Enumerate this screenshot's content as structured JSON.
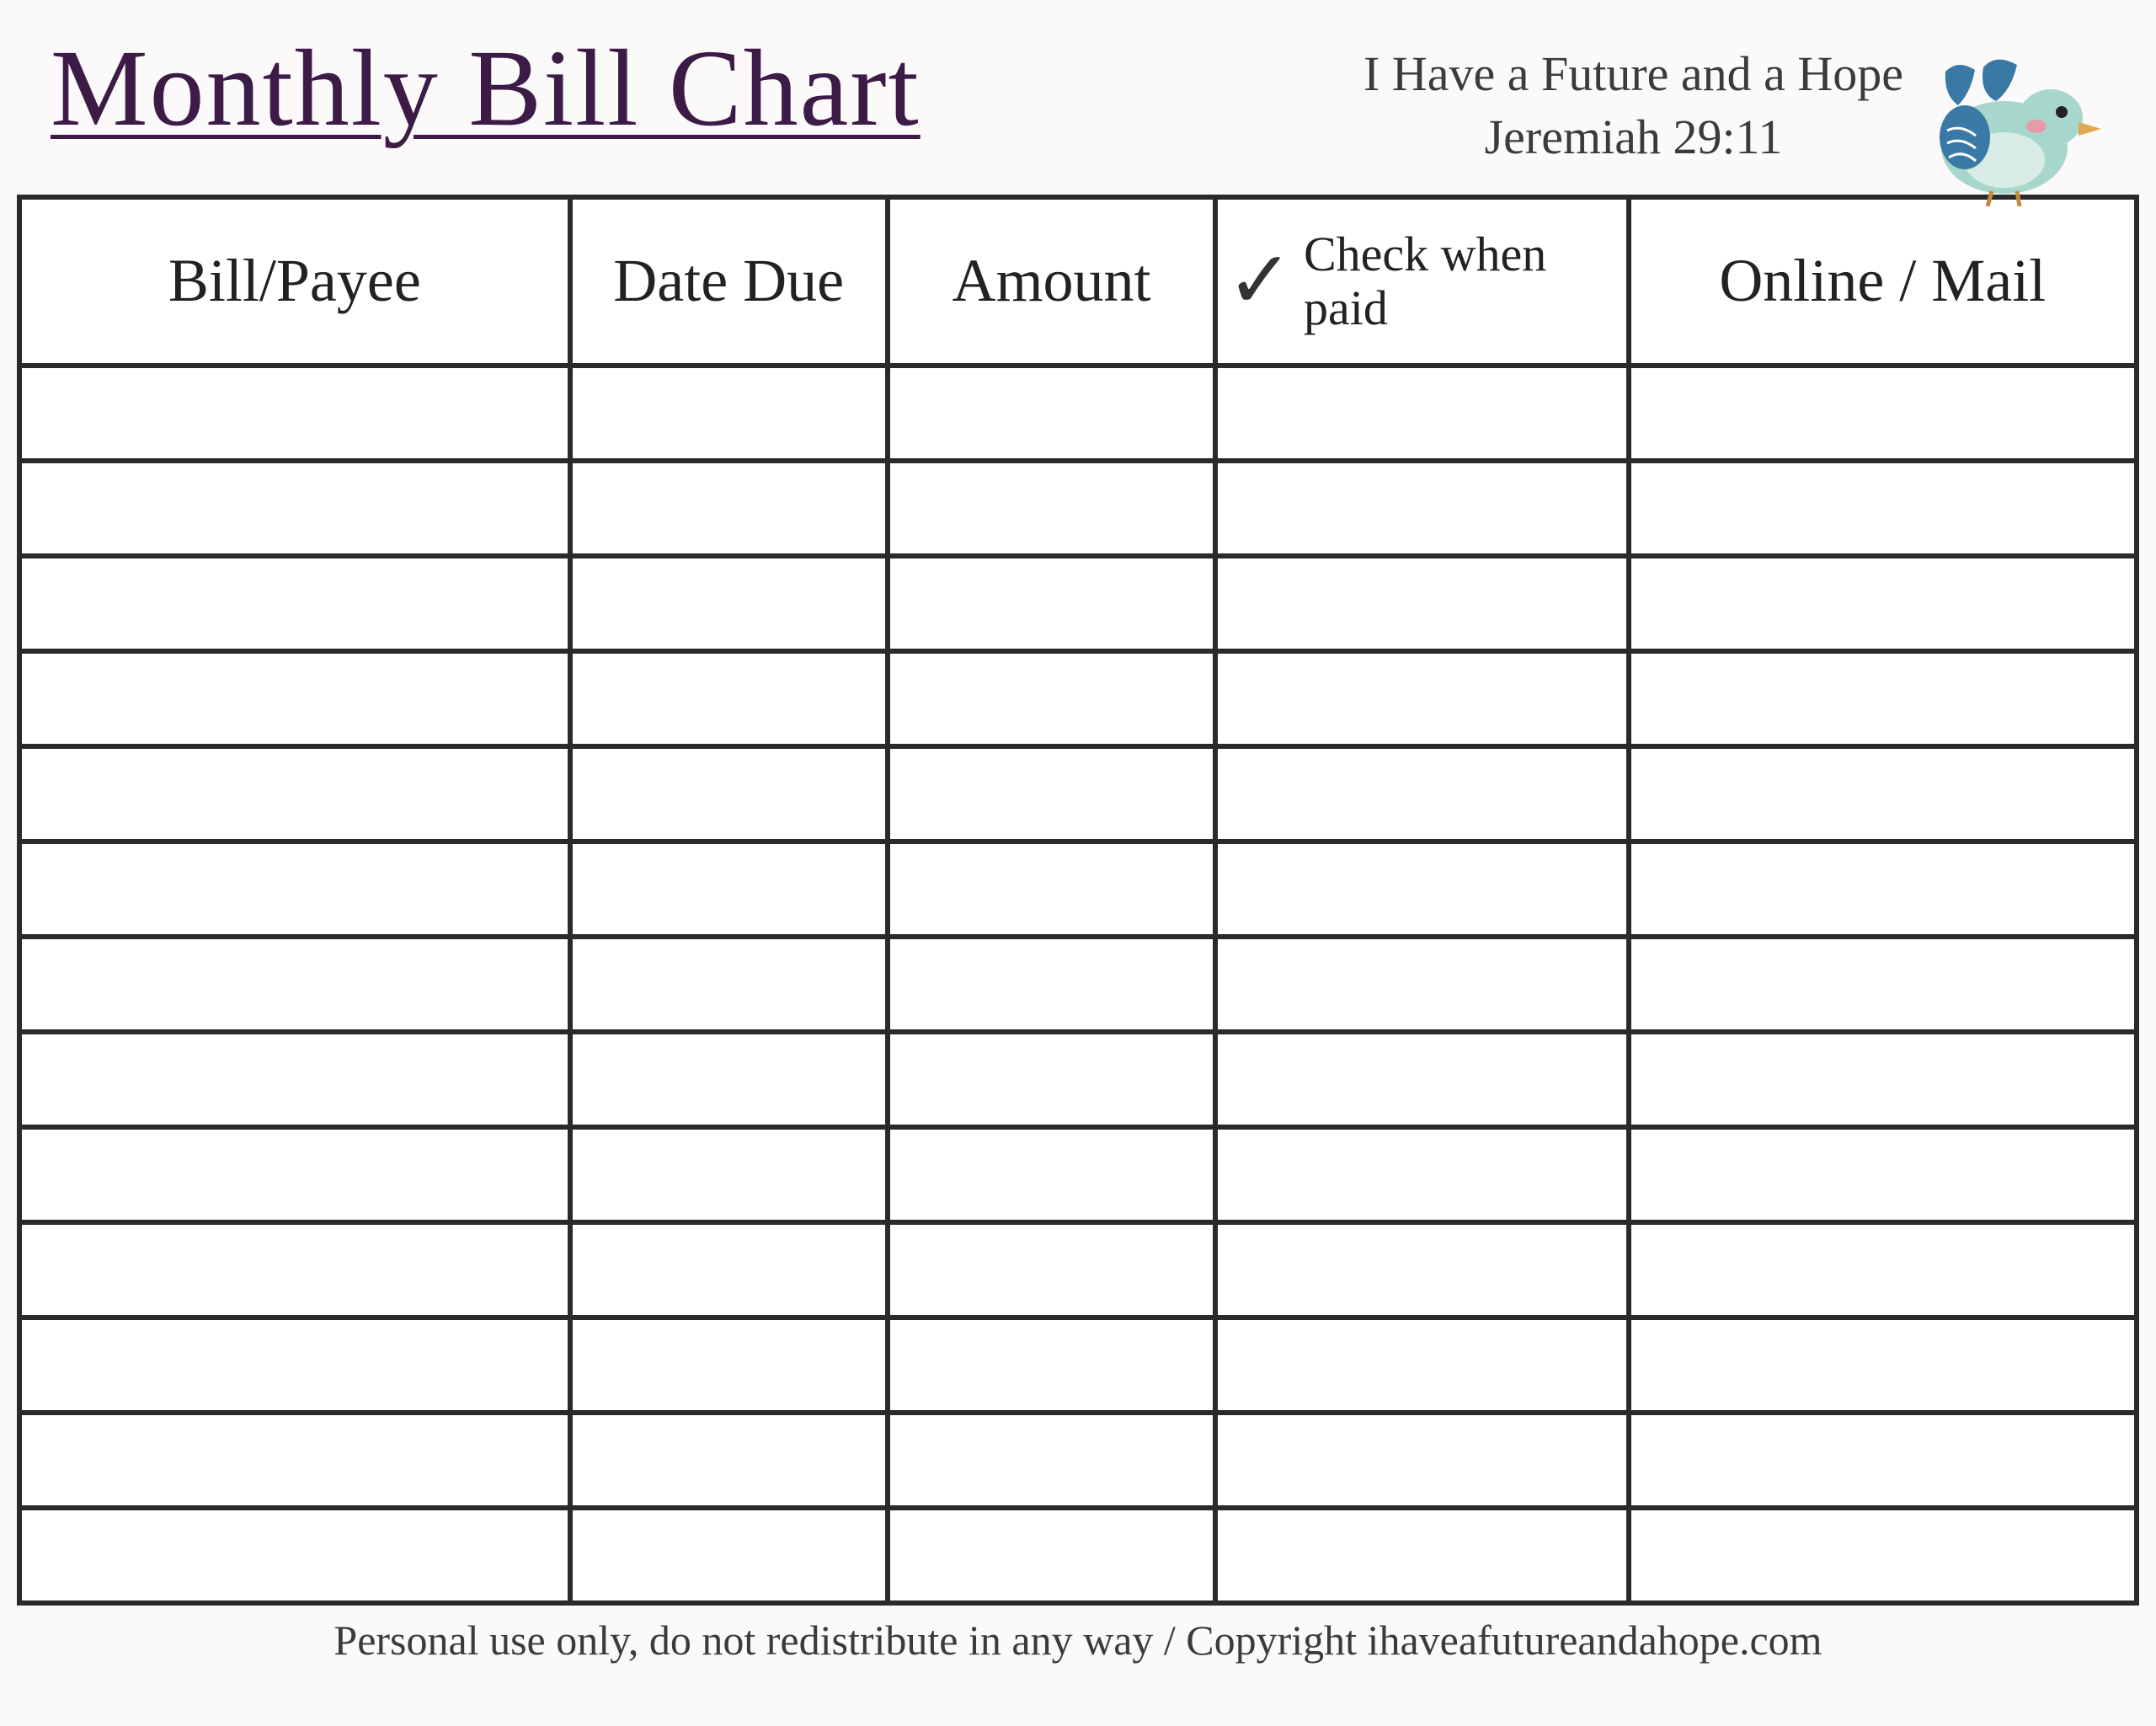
{
  "header": {
    "title": "Monthly Bill Chart",
    "scripture_line1": "I Have a Future and a Hope",
    "scripture_line2": "Jeremiah 29:11"
  },
  "columns": {
    "bill_payee": "Bill/Payee",
    "date_due": "Date Due",
    "amount": "Amount",
    "check_when_paid": "Check when paid",
    "online_mail": "Online / Mail"
  },
  "rows": [
    {
      "bill_payee": "",
      "date_due": "",
      "amount": "",
      "check_when_paid": "",
      "online_mail": ""
    },
    {
      "bill_payee": "",
      "date_due": "",
      "amount": "",
      "check_when_paid": "",
      "online_mail": ""
    },
    {
      "bill_payee": "",
      "date_due": "",
      "amount": "",
      "check_when_paid": "",
      "online_mail": ""
    },
    {
      "bill_payee": "",
      "date_due": "",
      "amount": "",
      "check_when_paid": "",
      "online_mail": ""
    },
    {
      "bill_payee": "",
      "date_due": "",
      "amount": "",
      "check_when_paid": "",
      "online_mail": ""
    },
    {
      "bill_payee": "",
      "date_due": "",
      "amount": "",
      "check_when_paid": "",
      "online_mail": ""
    },
    {
      "bill_payee": "",
      "date_due": "",
      "amount": "",
      "check_when_paid": "",
      "online_mail": ""
    },
    {
      "bill_payee": "",
      "date_due": "",
      "amount": "",
      "check_when_paid": "",
      "online_mail": ""
    },
    {
      "bill_payee": "",
      "date_due": "",
      "amount": "",
      "check_when_paid": "",
      "online_mail": ""
    },
    {
      "bill_payee": "",
      "date_due": "",
      "amount": "",
      "check_when_paid": "",
      "online_mail": ""
    },
    {
      "bill_payee": "",
      "date_due": "",
      "amount": "",
      "check_when_paid": "",
      "online_mail": ""
    },
    {
      "bill_payee": "",
      "date_due": "",
      "amount": "",
      "check_when_paid": "",
      "online_mail": ""
    },
    {
      "bill_payee": "",
      "date_due": "",
      "amount": "",
      "check_when_paid": "",
      "online_mail": ""
    }
  ],
  "footer": {
    "text": "Personal use only, do not redistribute in any way / Copyright ihaveafutureandahope.com"
  }
}
